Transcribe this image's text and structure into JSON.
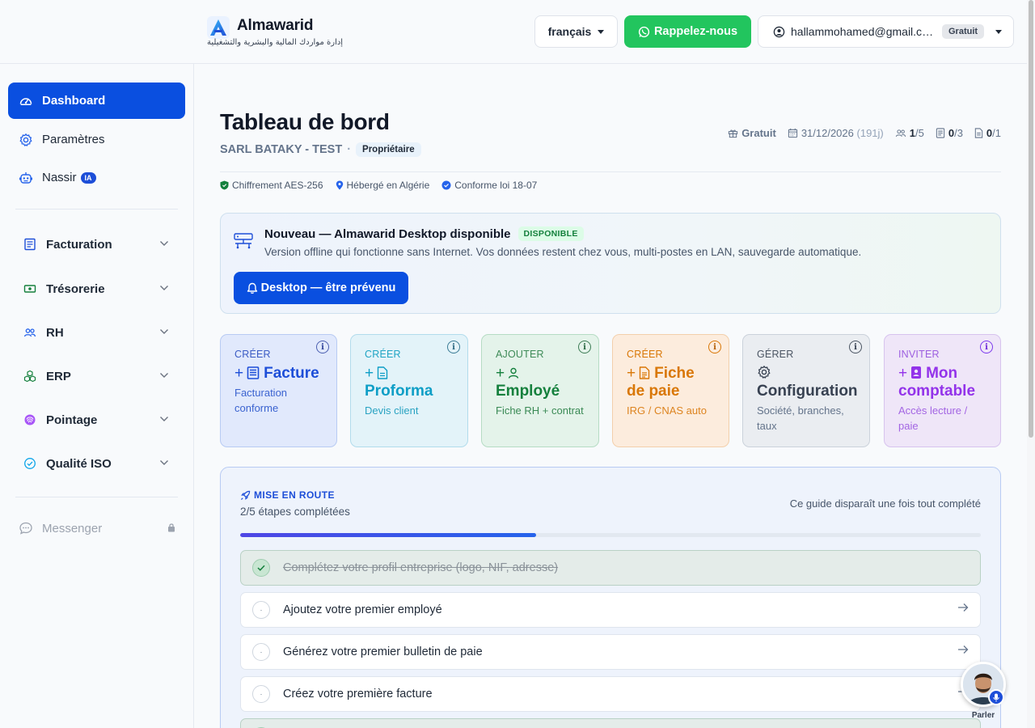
{
  "header": {
    "app_name": "Almawarid",
    "tagline": "إدارة مواردك المالية والبشرية والتشغيلية",
    "language": "français",
    "call_label": "Rappelez-nous",
    "user_email": "hallammohamed@gmail.com",
    "plan": "Gratuit"
  },
  "sidebar": {
    "top_items": [
      {
        "label": "Dashboard",
        "icon": "gauge-icon",
        "active": true
      },
      {
        "label": "Paramètres",
        "icon": "gear-icon"
      },
      {
        "label": "Nassir",
        "icon": "robot-icon",
        "badge": "IA"
      }
    ],
    "groups": [
      {
        "label": "Facturation",
        "icon": "invoice-icon"
      },
      {
        "label": "Trésorerie",
        "icon": "cash-icon"
      },
      {
        "label": "RH",
        "icon": "users-icon"
      },
      {
        "label": "ERP",
        "icon": "cubes-icon"
      },
      {
        "label": "Pointage",
        "icon": "fingerprint-icon"
      },
      {
        "label": "Qualité ISO",
        "icon": "check-circle-icon"
      }
    ],
    "messenger": "Messenger"
  },
  "main": {
    "title": "Tableau de bord",
    "company": "SARL BATAKY - TEST",
    "separator": "·",
    "role": "Propriétaire",
    "stats": {
      "plan": "Gratuit",
      "expiry": "31/12/2026",
      "days_left": "(191j)",
      "users_used": "1",
      "users_total": "/5",
      "invoices_used": "0",
      "invoices_total": "/3",
      "docs_used": "0",
      "docs_total": "/1"
    },
    "trust": [
      "Chiffrement AES-256",
      "Hébergé en Algérie",
      "Conforme loi 18-07"
    ],
    "banner": {
      "title": "Nouveau — Almawarid Desktop disponible",
      "badge": "DISPONIBLE",
      "description": "Version offline qui fonctionne sans Internet. Vos données restent chez vous, multi-postes en LAN, sauvegarde automatique.",
      "button": "Desktop — être prévenu"
    },
    "cards": [
      {
        "kicker": "CRÉER",
        "title": "Facture",
        "subtitle": "Facturation conforme"
      },
      {
        "kicker": "CRÉER",
        "title": "Proforma",
        "subtitle": "Devis client"
      },
      {
        "kicker": "AJOUTER",
        "title": "Employé",
        "subtitle": "Fiche RH + contrat"
      },
      {
        "kicker": "CRÉER",
        "title": "Fiche de paie",
        "subtitle": "IRG / CNAS auto"
      },
      {
        "kicker": "GÉRER",
        "title": "Configuration",
        "subtitle": "Société, branches, taux"
      },
      {
        "kicker": "INVITER",
        "title": "Mon comptable",
        "subtitle": "Accès lecture / paie"
      }
    ],
    "guide": {
      "kicker": "MISE EN ROUTE",
      "count": "2/5 étapes complétées",
      "note": "Ce guide disparaît une fois tout complété",
      "progress": 0.4,
      "steps": [
        {
          "label": "Complétez votre profil entreprise (logo, NIF, adresse)",
          "done": true
        },
        {
          "label": "Ajoutez votre premier employé",
          "done": false
        },
        {
          "label": "Générez votre premier bulletin de paie",
          "done": false
        },
        {
          "label": "Créez votre première facture",
          "done": false
        }
      ]
    }
  },
  "assistant": {
    "label": "Parler"
  },
  "colors": {
    "primary": "#0a4fe0",
    "whatsapp": "#22c55e",
    "success": "#15803d"
  }
}
